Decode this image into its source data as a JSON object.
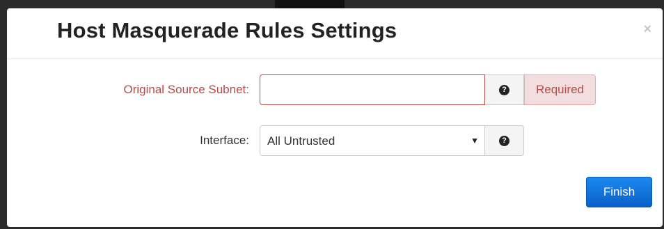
{
  "dialog": {
    "title": "Host Masquerade Rules Settings",
    "close_glyph": "×"
  },
  "form": {
    "source_subnet": {
      "label": "Original Source Subnet:",
      "value": "",
      "placeholder": "",
      "validation": "Required",
      "help_glyph": "?"
    },
    "interface": {
      "label": "Interface:",
      "selected": "All Untrusted",
      "caret_glyph": "▼",
      "help_glyph": "?"
    }
  },
  "actions": {
    "finish_label": "Finish"
  },
  "colors": {
    "error": "#b94a48",
    "error_bg": "#f2dede",
    "primary": "#0a5fc7"
  },
  "icons": [
    "close-icon",
    "help-icon",
    "chevron-down-icon"
  ]
}
